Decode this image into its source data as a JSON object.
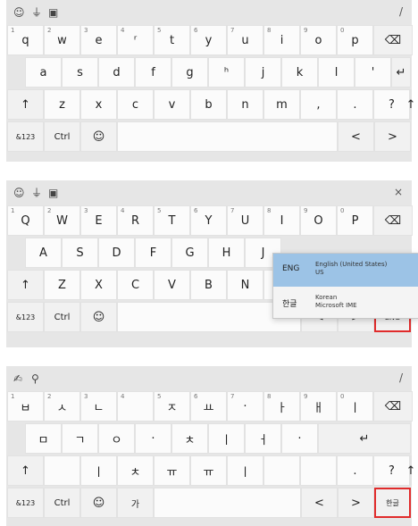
{
  "kb1": {
    "toolbar_icons": [
      "emoji-icon",
      "mic-icon",
      "clipboard-icon"
    ],
    "toolbar_right": "/",
    "row1": [
      [
        "1",
        "q"
      ],
      [
        "2",
        "w"
      ],
      [
        "3",
        "e"
      ],
      [
        "4",
        "ʳ"
      ],
      [
        "5",
        "t"
      ],
      [
        "6",
        "y"
      ],
      [
        "7",
        "u"
      ],
      [
        "8",
        "i"
      ],
      [
        "9",
        "o"
      ],
      [
        "0",
        "p"
      ]
    ],
    "row2": [
      "a",
      "s",
      "d",
      "f",
      "g",
      "ʰ",
      "j",
      "k",
      "l",
      "'"
    ],
    "row3": [
      "z",
      "x",
      "c",
      "v",
      "b",
      "n",
      "m",
      ",",
      ".",
      "?"
    ],
    "special": {
      "backspace": "⌫",
      "enter": "↵",
      "shift": "↑",
      "shift_right": "↑",
      "sym": "&123",
      "ctrl": "Ctrl",
      "emoji": "☺",
      "left": "<",
      "right": ">"
    }
  },
  "kb2": {
    "toolbar_icons": [
      "emoji-icon",
      "mic-icon",
      "clipboard-icon"
    ],
    "toolbar_right": "×",
    "row1": [
      [
        "1",
        "Q"
      ],
      [
        "2",
        "W"
      ],
      [
        "3",
        "E"
      ],
      [
        "4",
        "R"
      ],
      [
        "5",
        "T"
      ],
      [
        "6",
        "Y"
      ],
      [
        "7",
        "U"
      ],
      [
        "8",
        "I"
      ],
      [
        "9",
        "O"
      ],
      [
        "0",
        "P"
      ]
    ],
    "row2": [
      "A",
      "S",
      "D",
      "F",
      "G",
      "H",
      "J"
    ],
    "row3": [
      "Z",
      "X",
      "C",
      "V",
      "B",
      "N",
      "M"
    ],
    "special": {
      "backspace": "⌫",
      "shift": "↑",
      "sym": "&123",
      "ctrl": "Ctrl",
      "emoji": "☺",
      "left": "<",
      "right": ">",
      "lang": "ENG"
    },
    "lang_popup": [
      {
        "code": "ENG",
        "name": "English (United States)",
        "sub": "US"
      },
      {
        "code": "한글",
        "name": "Korean",
        "sub": "Microsoft IME"
      }
    ]
  },
  "kb3": {
    "toolbar_icons": [
      "handwriting-icon",
      "pin-icon"
    ],
    "toolbar_right": "/",
    "row1": [
      [
        "1",
        "ㅂ"
      ],
      [
        "2",
        "ㅅ"
      ],
      [
        "3",
        "ㄴ"
      ],
      [
        "4",
        ""
      ],
      [
        "5",
        "ㅈ"
      ],
      [
        "6",
        "ㅛ"
      ],
      [
        "7",
        "·"
      ],
      [
        "8",
        "ㅏ"
      ],
      [
        "9",
        "ㅐ"
      ],
      [
        "0",
        "ㅣ"
      ]
    ],
    "row2": [
      "ㅁ",
      "ㄱ",
      "ㅇ",
      "·",
      "ㅊ",
      "ㅣ",
      "ㅓ",
      "·"
    ],
    "row3": [
      "",
      "ㅣ",
      "ㅊ",
      "ㅠ",
      "ㅠ",
      "ㅣ",
      "",
      "",
      ".",
      "?"
    ],
    "special": {
      "backspace": "⌫",
      "enter": "↵",
      "shift": "↑",
      "shift_right": "↑",
      "sym": "&123",
      "ctrl": "Ctrl",
      "emoji": "☺",
      "extra": "가",
      "left": "<",
      "right": ">",
      "lang": "한글"
    }
  }
}
